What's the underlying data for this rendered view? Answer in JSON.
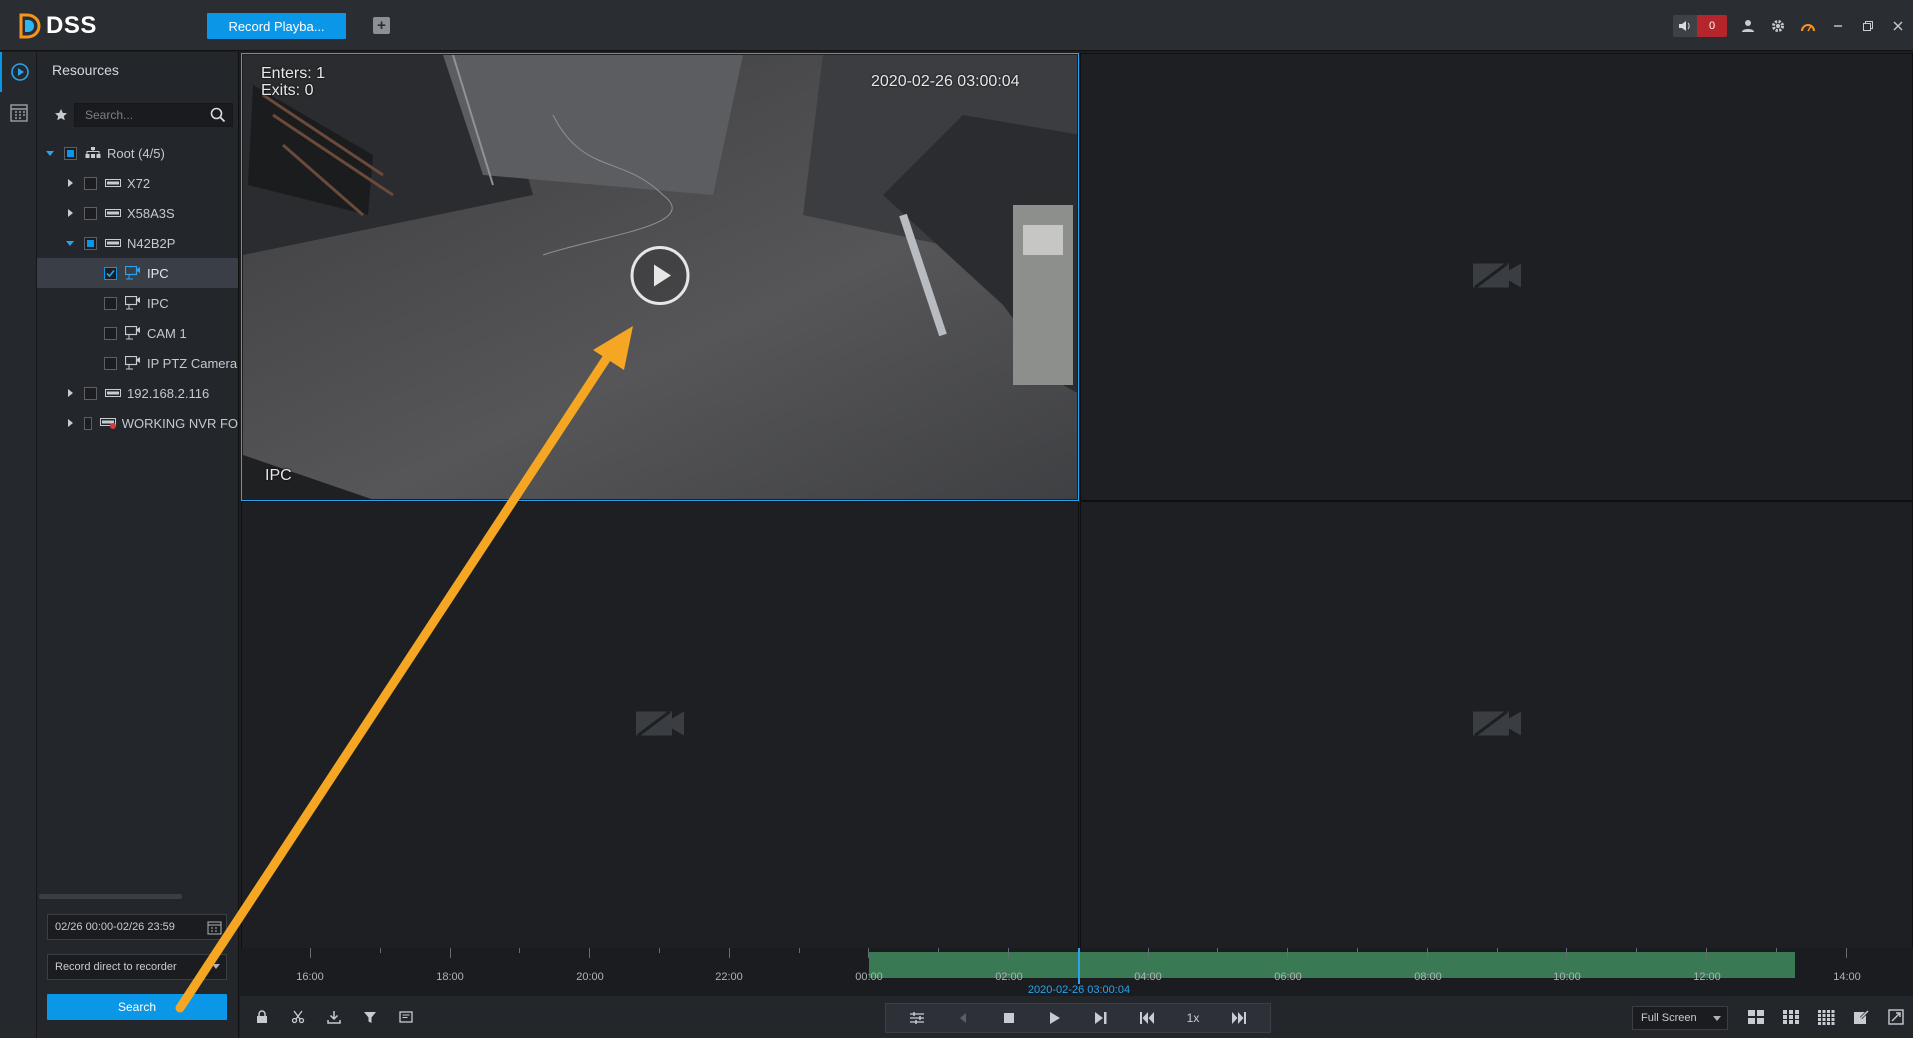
{
  "app": {
    "logo_text": "DSS",
    "accent": "#0a97e8"
  },
  "tabs": [
    {
      "label": "Record Playba..."
    }
  ],
  "titlebar": {
    "alarm_count": "0"
  },
  "sidebar": {
    "title": "Resources",
    "search_placeholder": "Search...",
    "tree": [
      {
        "label": "Root (4/5)",
        "type": "root",
        "expanded": true,
        "check": "partial"
      },
      {
        "label": "X72",
        "type": "nvr",
        "expanded": false,
        "check": "none"
      },
      {
        "label": "X58A3S",
        "type": "nvr",
        "expanded": false,
        "check": "none"
      },
      {
        "label": "N42B2P",
        "type": "nvr",
        "expanded": true,
        "check": "partial"
      },
      {
        "label": "IPC",
        "type": "camera",
        "check": "checked",
        "selected": true
      },
      {
        "label": "IPC",
        "type": "camera",
        "check": "none"
      },
      {
        "label": "CAM 1",
        "type": "camera",
        "check": "none"
      },
      {
        "label": "IP PTZ Camera",
        "type": "camera",
        "check": "none"
      },
      {
        "label": "192.168.2.116",
        "type": "nvr",
        "expanded": false,
        "check": "none"
      },
      {
        "label": "WORKING NVR FO",
        "type": "nvr-alert",
        "expanded": false,
        "check": "none"
      }
    ],
    "date_range": "02/26 00:00-02/26 23:59",
    "record_source": "Record direct to recorder",
    "search_button": "Search"
  },
  "video": {
    "active_pane": {
      "enters": "Enters: 1",
      "exits": "Exits: 0",
      "timestamp": "2020-02-26 03:00:04",
      "channel": "IPC"
    }
  },
  "timeline": {
    "labels": [
      "16:00",
      "18:00",
      "20:00",
      "22:00",
      "00:00",
      "02:00",
      "04:00",
      "06:00",
      "08:00",
      "10:00",
      "12:00",
      "14:00"
    ],
    "current": "2020-02-26 03:00:04",
    "recording_color": "#3f8a5e"
  },
  "controls": {
    "speed": "1x",
    "fullscreen_option": "Full Screen"
  }
}
